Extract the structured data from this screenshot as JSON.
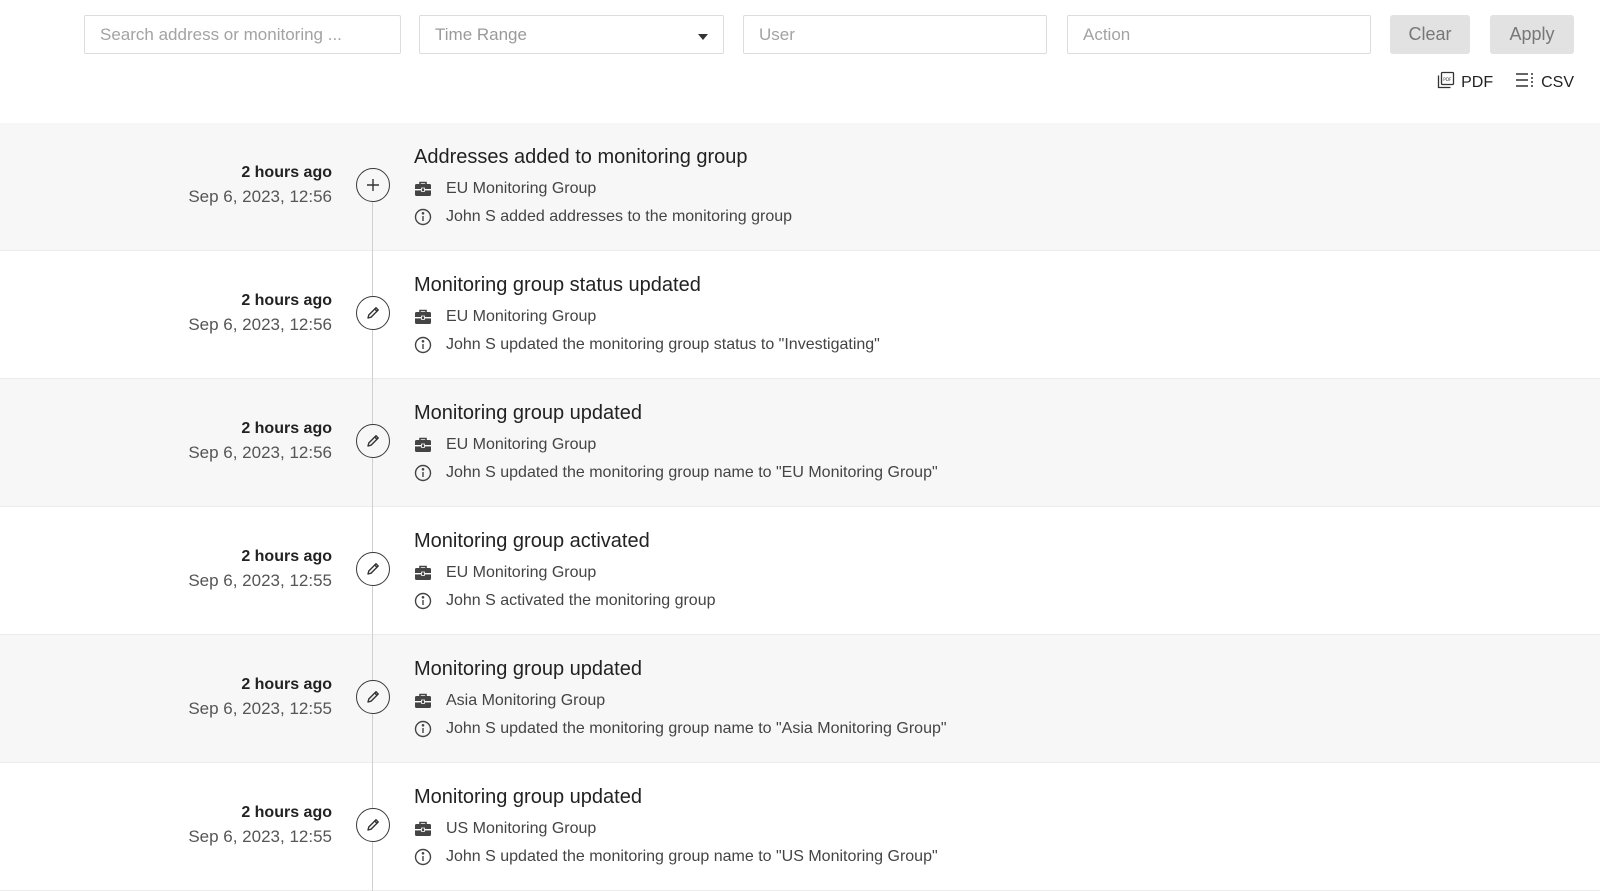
{
  "filters": {
    "search_placeholder": "Search address or monitoring ...",
    "time_range_label": "Time Range",
    "user_placeholder": "User",
    "action_placeholder": "Action",
    "clear_label": "Clear",
    "apply_label": "Apply"
  },
  "exports": {
    "pdf_label": "PDF",
    "csv_label": "CSV"
  },
  "events": [
    {
      "icon": "plus-icon",
      "relative": "2 hours ago",
      "datetime": "Sep 6, 2023, 12:56",
      "title": "Addresses added to monitoring group",
      "group": "EU Monitoring Group",
      "description": "John S added addresses to the monitoring group"
    },
    {
      "icon": "pencil-icon",
      "relative": "2 hours ago",
      "datetime": "Sep 6, 2023, 12:56",
      "title": "Monitoring group status updated",
      "group": "EU Monitoring Group",
      "description": "John S updated the monitoring group status to \"Investigating\""
    },
    {
      "icon": "pencil-icon",
      "relative": "2 hours ago",
      "datetime": "Sep 6, 2023, 12:56",
      "title": "Monitoring group updated",
      "group": "EU Monitoring Group",
      "description": "John S updated the monitoring group name to \"EU Monitoring Group\""
    },
    {
      "icon": "pencil-icon",
      "relative": "2 hours ago",
      "datetime": "Sep 6, 2023, 12:55",
      "title": "Monitoring group activated",
      "group": "EU Monitoring Group",
      "description": "John S activated the monitoring group"
    },
    {
      "icon": "pencil-icon",
      "relative": "2 hours ago",
      "datetime": "Sep 6, 2023, 12:55",
      "title": "Monitoring group updated",
      "group": "Asia Monitoring Group",
      "description": "John S updated the monitoring group name to \"Asia Monitoring Group\""
    },
    {
      "icon": "pencil-icon",
      "relative": "2 hours ago",
      "datetime": "Sep 6, 2023, 12:55",
      "title": "Monitoring group updated",
      "group": "US Monitoring Group",
      "description": "John S updated the monitoring group name to \"US Monitoring Group\""
    }
  ]
}
